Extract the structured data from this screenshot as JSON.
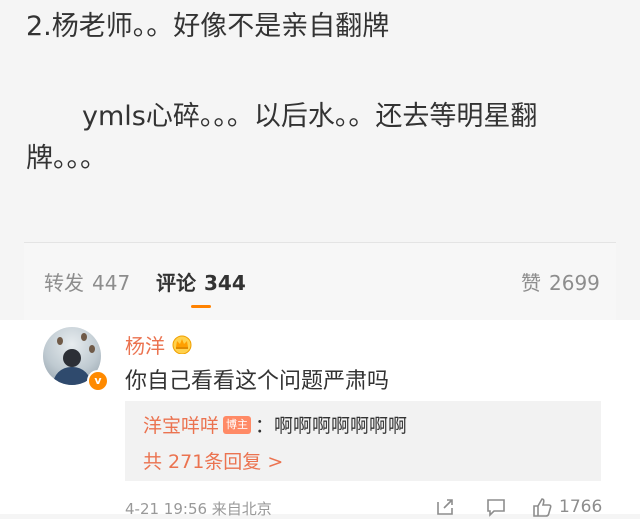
{
  "post": {
    "line1": "2.杨老师。。好像不是亲自翻牌",
    "line2": "ymls心碎。。。以后水。。还去等明星翻牌。。。"
  },
  "tabs": [
    {
      "label": "转发",
      "count": "447"
    },
    {
      "label": "评论",
      "count": "344"
    },
    {
      "label": "赞",
      "count": "2699"
    }
  ],
  "comment": {
    "username": "杨洋",
    "verified_mark": "v",
    "text": "你自己看看这个问题严肃吗",
    "reply": {
      "user": "洋宝咩咩",
      "badge": "博主",
      "separator": "：",
      "text": "啊啊啊啊啊啊啊",
      "more": "共 271条回复 >"
    },
    "meta": "4-21 19:56  来自北京",
    "likes": "1766"
  },
  "colors": {
    "accent": "#ff8200",
    "username": "#eb7350",
    "text": "#333333",
    "muted": "#8d8d8d"
  }
}
